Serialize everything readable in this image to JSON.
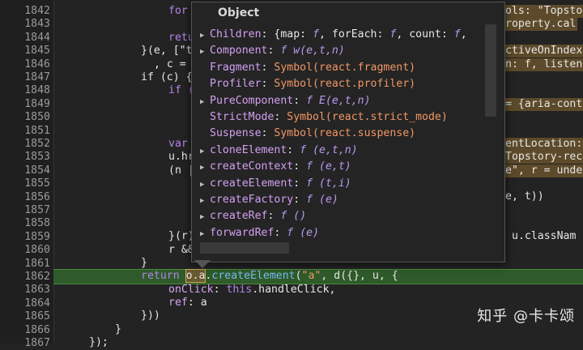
{
  "gutter": {
    "lines": [
      "1842",
      "1843",
      "1844",
      "1845",
      "1846",
      "1847",
      "1848",
      "1849",
      "1850",
      "1851",
      "1852",
      "1853",
      "1854",
      "1855",
      "1856",
      "1857",
      "1858",
      "1859",
      "1860",
      "1861",
      "1862",
      "1863",
      "1864",
      "1865",
      "1866",
      "1867"
    ]
  },
  "code": {
    "l1842": "for",
    "l1844": "retu",
    "l1845": "}(e, [\"t",
    "l1846": ", c =",
    "l1847": "if (c) {",
    "l1848": "if (",
    "l1852": "var",
    "l1853": "u.hr",
    "l1854": "(n |",
    "l1859": "}(r)",
    "l1860": "r &&",
    "l1861": "}",
    "l1862a": "return",
    "l1862b": "o.a",
    "l1862c": ".",
    "l1862d": "createElement",
    "l1862e": "(",
    "l1862f": "\"a\"",
    "l1862g": ", d({}, u, {",
    "l1863a": "onClick",
    "l1863b": ": ",
    "l1863c": "this",
    "l1863d": ".handleClick,",
    "l1864a": "ref",
    "l1864b": ": a",
    "l1865": "}))",
    "l1866": "}",
    "l1867": "});",
    "r1842": "ols: \"Topsto",
    "r1843": "roperty.cal",
    "r1845": "ctiveOnIndex",
    "r1846": "n: f, listen",
    "r1849": "= {aria-cont",
    "r1852": "entLocation:",
    "r1853": "Topstory-rec",
    "r1854": "e\", r = unde",
    "r1856": "e, t))",
    "r1859": "u.classNam"
  },
  "popup": {
    "title": "Object",
    "rows": [
      {
        "key": "Children",
        "sep": ": ",
        "val": "{map: ",
        "f1": "f",
        ", ": ", ",
        "v2": "forEach: ",
        "f2": "f",
        "v3": ", count: ",
        "f3": "f",
        "v4": ","
      },
      {
        "key": "Component",
        "sep": ": ",
        "f": "f",
        "val": " w(e,t,n)"
      },
      {
        "key": "Fragment",
        "sep": ": ",
        "val": "Symbol(react.fragment)"
      },
      {
        "key": "Profiler",
        "sep": ": ",
        "val": "Symbol(react.profiler)"
      },
      {
        "key": "PureComponent",
        "sep": ": ",
        "f": "f",
        "val": " E(e,t,n)"
      },
      {
        "key": "StrictMode",
        "sep": ": ",
        "val": "Symbol(react.strict_mode)"
      },
      {
        "key": "Suspense",
        "sep": ": ",
        "val": "Symbol(react.suspense)"
      },
      {
        "key": "cloneElement",
        "sep": ": ",
        "f": "f",
        "val": " (e,t,n)"
      },
      {
        "key": "createContext",
        "sep": ": ",
        "f": "f",
        "val": " (e,t)"
      },
      {
        "key": "createElement",
        "sep": ": ",
        "f": "f",
        "val": " (t,i)"
      },
      {
        "key": "createFactory",
        "sep": ": ",
        "f": "f",
        "val": " (e)"
      },
      {
        "key": "createRef",
        "sep": ": ",
        "f": "f",
        "val": " ()"
      },
      {
        "key": "forwardRef",
        "sep": ": ",
        "f": "f",
        "val": " (e)"
      }
    ]
  },
  "watermark": "知乎 @卡卡颂"
}
